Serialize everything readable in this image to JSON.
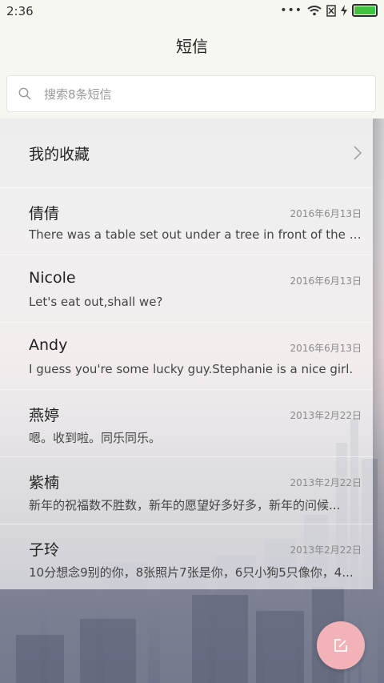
{
  "status_bar": {
    "time": "2:36",
    "icons": [
      "more-dots-icon",
      "wifi-icon",
      "sim-off-icon",
      "charging-icon",
      "battery-icon"
    ]
  },
  "header": {
    "title": "短信"
  },
  "search": {
    "placeholder": "搜索8条短信"
  },
  "favorites": {
    "label": "我的收藏"
  },
  "messages": [
    {
      "name": "倩倩",
      "date": "2016年6月13日",
      "preview": "There was a table set out under a tree in front of the ho..."
    },
    {
      "name": "Nicole",
      "date": "2016年6月13日",
      "preview": "Let's eat out,shall we?"
    },
    {
      "name": "Andy",
      "date": "2016年6月13日",
      "preview": "I guess you're some lucky guy.Stephanie is a nice girl."
    },
    {
      "name": "燕婷",
      "date": "2013年2月22日",
      "preview": "嗯。收到啦。同乐同乐。"
    },
    {
      "name": "紫楠",
      "date": "2013年2月22日",
      "preview": "新年的祝福数不胜数，新年的愿望好多好多，新年的问候..."
    },
    {
      "name": "子玲",
      "date": "2013年2月22日",
      "preview": "10分想念9别的你，8张照片7张是你，6只小狗5只像你，4..."
    }
  ],
  "compose_button": {
    "icon": "compose-icon"
  },
  "colors": {
    "accent_fab": "#f2b3b8",
    "battery": "#3fc33f",
    "header_bg": "#f7f7f2"
  }
}
